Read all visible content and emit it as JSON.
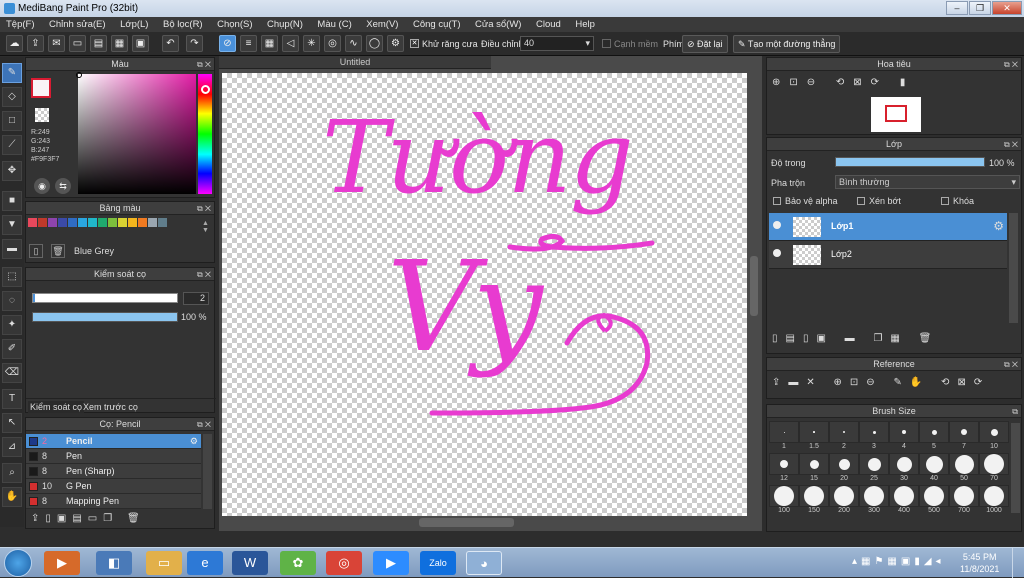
{
  "app": {
    "title": "MediBang Paint Pro (32bit)"
  },
  "menu": [
    "Tệp(F)",
    "Chỉnh sửa(E)",
    "Lớp(L)",
    "Bộ lọc(R)",
    "Chọn(S)",
    "Chụp(N)",
    "Màu (C)",
    "Xem(V)",
    "Công cụ(T)",
    "Cửa sổ(W)",
    "Cloud",
    "Help"
  ],
  "toolbar": {
    "antialias": "Khử răng cưa",
    "adjust": "Điều chỉnh",
    "adjust_value": "40",
    "edge": "Cạnh mềm",
    "key": "Phím",
    "set": "Đặt lại",
    "straight": "Tạo một đường thẳng"
  },
  "color_panel": {
    "title": "Màu",
    "r": "R:249",
    "g": "G:243",
    "b": "B:247",
    "hex": "#F9F3F7"
  },
  "palette_panel": {
    "title": "Bảng màu",
    "swatch_name": "Blue Grey",
    "swatches": [
      "#e8485c",
      "#c0392b",
      "#8e44ad",
      "#3b4aa8",
      "#2f6cc4",
      "#2aa6e0",
      "#20b7c9",
      "#1faa6e",
      "#7dbf3c",
      "#d9d232",
      "#f3b51d",
      "#f07a21",
      "#9aa6b0",
      "#607d8b"
    ]
  },
  "brush_control": {
    "title": "Kiểm soát cọ",
    "size": "2",
    "opacity": "100 %",
    "opacity_value": 1.0
  },
  "brush_tabs": [
    "Kiểm soát cọ",
    "Xem trước cọ"
  ],
  "brush_panel": {
    "title": "Cọ: Pencil",
    "items": [
      {
        "size": "2",
        "name": "Pencil",
        "color": "#1e3a8a"
      },
      {
        "size": "8",
        "name": "Pen",
        "color": "#1a1a1a"
      },
      {
        "size": "8",
        "name": "Pen (Sharp)",
        "color": "#1a1a1a"
      },
      {
        "size": "10",
        "name": "G Pen",
        "color": "#d32f2f"
      },
      {
        "size": "8",
        "name": "Mapping Pen",
        "color": "#d32f2f"
      }
    ]
  },
  "canvas": {
    "tab": "Untitled",
    "line1": "Tường",
    "line2": "Vy",
    "ink": "#e83bd0"
  },
  "navigator": {
    "title": "Hoa tiêu"
  },
  "layer_panel": {
    "title": "Lớp",
    "opacity_label": "Độ trong",
    "opacity": "100 %",
    "opacity_value": 1.0,
    "blend_label": "Pha trộn",
    "blend": "Bình thường",
    "protect_alpha": "Bảo vệ alpha",
    "clip": "Xén bớt",
    "lock": "Khóa",
    "layers": [
      {
        "name": "Lớp1",
        "selected": true
      },
      {
        "name": "Lớp2",
        "selected": false
      }
    ]
  },
  "reference": {
    "title": "Reference"
  },
  "brush_size": {
    "title": "Brush Size",
    "sizes": [
      "1",
      "1.5",
      "2",
      "3",
      "4",
      "5",
      "7",
      "10",
      "12",
      "15",
      "20",
      "25",
      "30",
      "40",
      "50",
      "70",
      "100",
      "150",
      "200",
      "300",
      "400",
      "500",
      "700",
      "1000"
    ]
  },
  "taskbar": {
    "time": "5:45 PM",
    "date": "11/8/2021"
  }
}
